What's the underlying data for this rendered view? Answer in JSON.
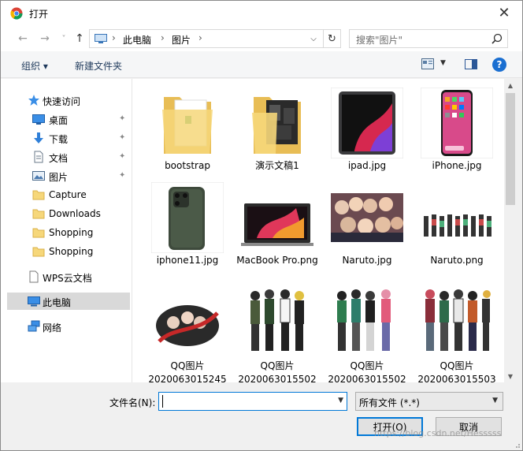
{
  "window": {
    "title": "打开",
    "close_glyph": "✕"
  },
  "nav": {
    "back": "←",
    "forward": "→",
    "recent": "˅",
    "up": "↑",
    "breadcrumb": [
      "此电脑",
      "图片"
    ],
    "separator": "›",
    "dropdown": "⌵",
    "refresh": "↻",
    "search_placeholder": "搜索\"图片\""
  },
  "toolbar": {
    "organize_label": "组织 ▾",
    "new_folder_label": "新建文件夹",
    "view_dropdown": "▼",
    "help_label": "?"
  },
  "sidebar": {
    "quick_access": "快速访问",
    "items": [
      {
        "label": "桌面",
        "icon": "desktop-icon",
        "pinned": true
      },
      {
        "label": "下载",
        "icon": "download-icon",
        "pinned": true
      },
      {
        "label": "文档",
        "icon": "document-icon",
        "pinned": true
      },
      {
        "label": "图片",
        "icon": "pictures-icon",
        "pinned": true
      },
      {
        "label": "Capture",
        "icon": "folder-icon",
        "pinned": false
      },
      {
        "label": "Downloads",
        "icon": "folder-icon",
        "pinned": false
      },
      {
        "label": "Shopping",
        "icon": "folder-icon",
        "pinned": false
      },
      {
        "label": "Shopping",
        "icon": "folder-icon",
        "pinned": false
      }
    ],
    "wps": "WPS云文档",
    "this_pc": "此电脑",
    "network": "网络",
    "pin_glyph": "📌"
  },
  "files": [
    {
      "name": "bootstrap",
      "kind": "folder"
    },
    {
      "name": "演示文稿1",
      "kind": "folder-images"
    },
    {
      "name": "ipad.jpg",
      "kind": "ipad"
    },
    {
      "name": "iPhone.jpg",
      "kind": "iphone"
    },
    {
      "name": "iphone11.jpg",
      "kind": "iphone11"
    },
    {
      "name": "MacBook Pro.png",
      "kind": "macbook"
    },
    {
      "name": "Naruto.jpg",
      "kind": "naruto-jpg"
    },
    {
      "name": "Naruto.png",
      "kind": "naruto-png"
    },
    {
      "name": "QQ图片 2020063015245",
      "kind": "qq1"
    },
    {
      "name": "QQ图片 2020063015502",
      "kind": "qq2"
    },
    {
      "name": "QQ图片 2020063015502",
      "kind": "qq3"
    },
    {
      "name": "QQ图片 2020063015503",
      "kind": "qq4"
    }
  ],
  "bottom": {
    "filename_label": "文件名(N):",
    "filename_value": "",
    "filetype_value": "所有文件 (*.*)",
    "open_label": "打开(O)",
    "cancel_label": "取消",
    "watermark": "https://blog.csdn.net/Hesssss"
  },
  "colors": {
    "accent": "#0078d7",
    "folder": "#f6d77a",
    "help": "#1a6fd1"
  }
}
